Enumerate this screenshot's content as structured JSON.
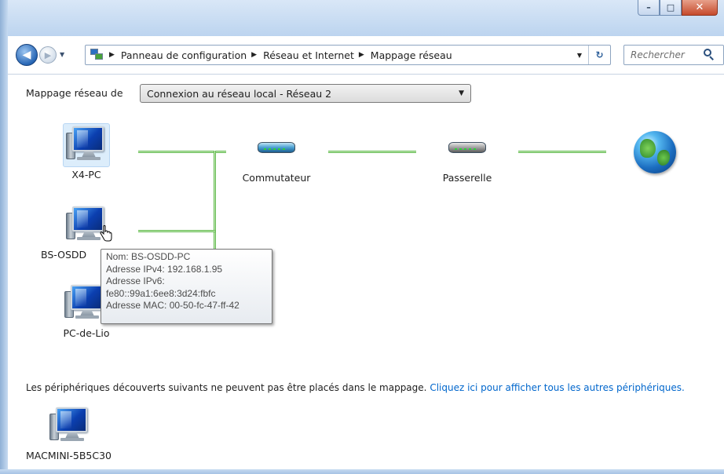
{
  "window": {
    "controls": {
      "minimize": "–",
      "maximize": "□",
      "close": "✕"
    }
  },
  "navigation": {
    "back_icon": "back-arrow-icon",
    "forward_icon": "forward-arrow-icon",
    "breadcrumbs": [
      "Panneau de configuration",
      "Réseau et Internet",
      "Mappage réseau"
    ],
    "search_placeholder": "Rechercher"
  },
  "map": {
    "label": "Mappage réseau de",
    "selected_network": "Connexion au réseau local - Réseau  2"
  },
  "nodes": {
    "x4pc": "X4-PC",
    "bsosdd": "BS-OSDD",
    "pcdelio": "PC-de-Lio",
    "switch": "Commutateur",
    "gateway": "Passerelle"
  },
  "tooltip": {
    "line1": "Nom: BS-OSDD-PC",
    "line2": "Adresse IPv4: 192.168.1.95",
    "line3": "Adresse IPv6:",
    "line4": "fe80::99a1:6ee8:3d24:fbfc",
    "line5": "Adresse MAC: 00-50-fc-47-ff-42"
  },
  "footer": {
    "text": "Les périphériques découverts suivants ne peuvent pas être placés dans le mappage.",
    "link": "Cliquez ici pour afficher tous les autres périphériques."
  },
  "unplaced_device": "MACMINI-5B5C30",
  "colors": {
    "link": "#0066cc",
    "connection_line": "#66bb53",
    "titlebar": "#bcd4ef"
  }
}
